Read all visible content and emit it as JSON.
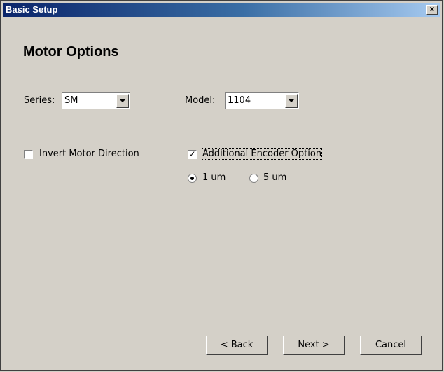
{
  "window": {
    "title": "Basic Setup",
    "close_glyph": "×"
  },
  "page": {
    "heading": "Motor Options"
  },
  "series": {
    "label": "Series:",
    "value": "SM"
  },
  "model": {
    "label": "Model:",
    "value": "1104"
  },
  "options": {
    "invert_direction": {
      "label": "Invert Motor Direction",
      "checked": false
    },
    "additional_encoder": {
      "label": "Additional Encoder Option",
      "checked": true,
      "mark": "✓"
    },
    "resolution": [
      {
        "label": "1 um",
        "selected": true
      },
      {
        "label": "5 um",
        "selected": false
      }
    ]
  },
  "buttons": {
    "back": "< Back",
    "next": "Next >",
    "cancel": "Cancel"
  }
}
